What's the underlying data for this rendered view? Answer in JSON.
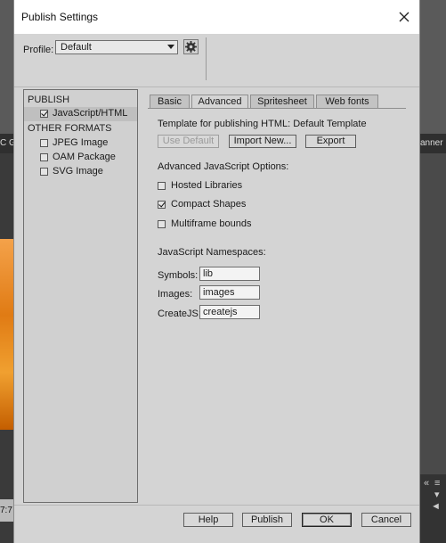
{
  "background": {
    "left_bar_text": "C G",
    "left_bottom_text": "7:7",
    "right_bar_text": "anner"
  },
  "dialog": {
    "title": "Publish Settings"
  },
  "profile": {
    "label": "Profile:",
    "value": "Default"
  },
  "left_panel": {
    "publish_header": "PUBLISH",
    "publish_items": [
      {
        "label": "JavaScript/HTML",
        "checked": true,
        "selected": true
      }
    ],
    "other_header": "OTHER FORMATS",
    "other_items": [
      {
        "label": "JPEG Image",
        "checked": false
      },
      {
        "label": "OAM Package",
        "checked": false
      },
      {
        "label": "SVG Image",
        "checked": false
      }
    ]
  },
  "tabs": [
    {
      "label": "Basic",
      "active": false
    },
    {
      "label": "Advanced",
      "active": true
    },
    {
      "label": "Spritesheet",
      "active": false
    },
    {
      "label": "Web fonts",
      "active": false
    }
  ],
  "advanced": {
    "template_text": "Template for publishing HTML: Default Template",
    "buttons": {
      "use_default": "Use Default",
      "import_new": "Import New...",
      "export": "Export"
    },
    "js_options_header": "Advanced JavaScript Options:",
    "options": [
      {
        "label": "Hosted Libraries",
        "checked": false
      },
      {
        "label": "Compact Shapes",
        "checked": true
      },
      {
        "label": "Multiframe bounds",
        "checked": false
      }
    ],
    "namespaces_header": "JavaScript Namespaces:",
    "namespaces": {
      "symbols_label": "Symbols:",
      "symbols_value": "lib",
      "images_label": "Images:",
      "images_value": "images",
      "createjs_label": "CreateJS:",
      "createjs_value": "createjs"
    }
  },
  "footer": {
    "help": "Help",
    "publish": "Publish",
    "ok": "OK",
    "cancel": "Cancel"
  }
}
